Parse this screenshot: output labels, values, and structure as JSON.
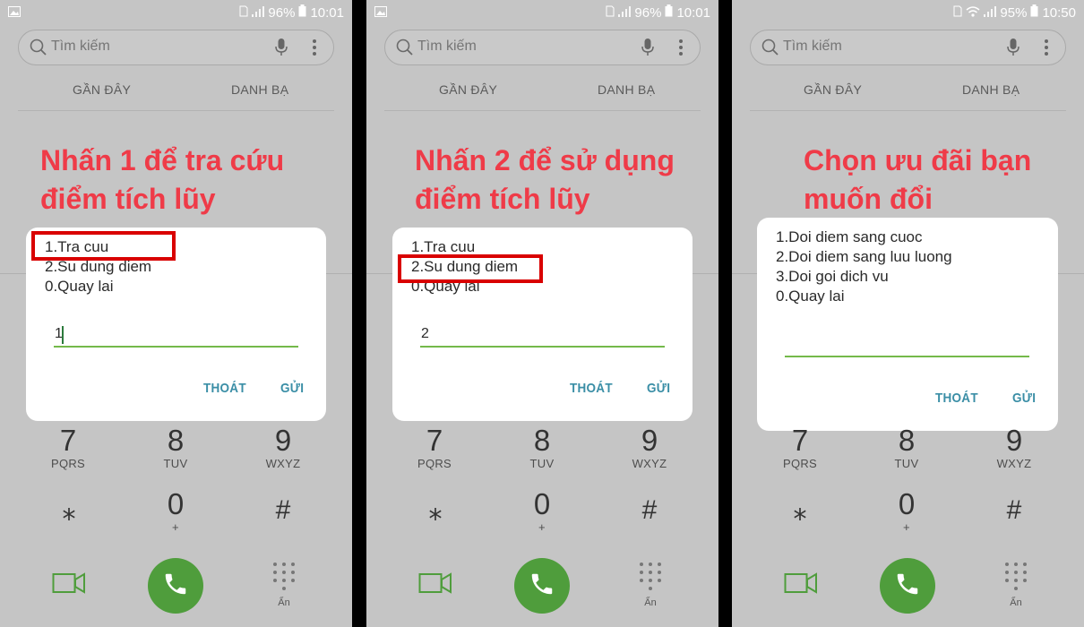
{
  "panels": [
    {
      "status": {
        "battery": "96%",
        "time": "10:01"
      },
      "search_placeholder": "Tìm kiếm",
      "tabs": [
        "GẦN ĐÂY",
        "DANH BẠ"
      ],
      "caption_lines": [
        "Nhấn 1 để tra cứu",
        "điểm tích lũy"
      ],
      "menu": [
        "1.Tra cuu",
        "2.Su dung diem",
        "0.Quay lai"
      ],
      "highlighted_item": "1.Tra cuu",
      "input_value": "1",
      "cancel_label": "THOÁT",
      "send_label": "GỬI"
    },
    {
      "status": {
        "battery": "96%",
        "time": "10:01"
      },
      "search_placeholder": "Tìm kiếm",
      "tabs": [
        "GẦN ĐÂY",
        "DANH BẠ"
      ],
      "caption_lines": [
        "Nhấn 2 để sử dụng",
        "điểm tích lũy"
      ],
      "menu": [
        "1.Tra cuu",
        "2.Su dung diem",
        "0.Quay lai"
      ],
      "highlighted_item": "2.Su dung diem",
      "input_value": "2",
      "cancel_label": "THOÁT",
      "send_label": "GỬI"
    },
    {
      "status": {
        "battery": "95%",
        "time": "10:50"
      },
      "search_placeholder": "Tìm kiếm",
      "tabs": [
        "GẦN ĐÂY",
        "DANH BẠ"
      ],
      "caption_lines": [
        "Chọn ưu đãi bạn",
        "muốn đổi"
      ],
      "menu": [
        "1.Doi diem sang cuoc",
        "2.Doi diem sang luu luong",
        "3.Doi goi dich vu",
        "0.Quay lai"
      ],
      "highlighted_item": "",
      "input_value": "",
      "cancel_label": "THOÁT",
      "send_label": "GỬI"
    }
  ],
  "keypad": {
    "row1": [
      {
        "digit": "7",
        "letters": "PQRS"
      },
      {
        "digit": "8",
        "letters": "TUV"
      },
      {
        "digit": "9",
        "letters": "WXYZ"
      }
    ],
    "row2": [
      {
        "symbol": "⁎"
      },
      {
        "digit": "0",
        "letters": "+"
      },
      {
        "symbol": "#"
      }
    ],
    "hide_label": "Ẩn"
  },
  "colors": {
    "caption": "#ef3b48",
    "highlight_box": "#d90000",
    "call_button": "#4f9d3c",
    "dialog_button": "#3a8ea6",
    "input_underline": "#74b94a"
  }
}
